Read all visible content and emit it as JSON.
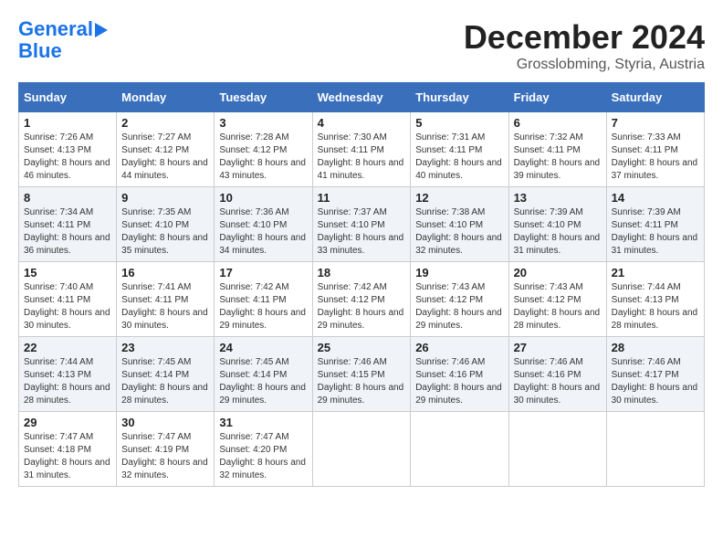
{
  "logo": {
    "line1": "General",
    "line2": "Blue",
    "arrow": true
  },
  "title": {
    "month": "December 2024",
    "location": "Grosslobming, Styria, Austria"
  },
  "weekdays": [
    "Sunday",
    "Monday",
    "Tuesday",
    "Wednesday",
    "Thursday",
    "Friday",
    "Saturday"
  ],
  "weeks": [
    [
      {
        "day": "1",
        "sunrise": "7:26 AM",
        "sunset": "4:13 PM",
        "daylight": "8 hours and 46 minutes."
      },
      {
        "day": "2",
        "sunrise": "7:27 AM",
        "sunset": "4:12 PM",
        "daylight": "8 hours and 44 minutes."
      },
      {
        "day": "3",
        "sunrise": "7:28 AM",
        "sunset": "4:12 PM",
        "daylight": "8 hours and 43 minutes."
      },
      {
        "day": "4",
        "sunrise": "7:30 AM",
        "sunset": "4:11 PM",
        "daylight": "8 hours and 41 minutes."
      },
      {
        "day": "5",
        "sunrise": "7:31 AM",
        "sunset": "4:11 PM",
        "daylight": "8 hours and 40 minutes."
      },
      {
        "day": "6",
        "sunrise": "7:32 AM",
        "sunset": "4:11 PM",
        "daylight": "8 hours and 39 minutes."
      },
      {
        "day": "7",
        "sunrise": "7:33 AM",
        "sunset": "4:11 PM",
        "daylight": "8 hours and 37 minutes."
      }
    ],
    [
      {
        "day": "8",
        "sunrise": "7:34 AM",
        "sunset": "4:11 PM",
        "daylight": "8 hours and 36 minutes."
      },
      {
        "day": "9",
        "sunrise": "7:35 AM",
        "sunset": "4:10 PM",
        "daylight": "8 hours and 35 minutes."
      },
      {
        "day": "10",
        "sunrise": "7:36 AM",
        "sunset": "4:10 PM",
        "daylight": "8 hours and 34 minutes."
      },
      {
        "day": "11",
        "sunrise": "7:37 AM",
        "sunset": "4:10 PM",
        "daylight": "8 hours and 33 minutes."
      },
      {
        "day": "12",
        "sunrise": "7:38 AM",
        "sunset": "4:10 PM",
        "daylight": "8 hours and 32 minutes."
      },
      {
        "day": "13",
        "sunrise": "7:39 AM",
        "sunset": "4:10 PM",
        "daylight": "8 hours and 31 minutes."
      },
      {
        "day": "14",
        "sunrise": "7:39 AM",
        "sunset": "4:11 PM",
        "daylight": "8 hours and 31 minutes."
      }
    ],
    [
      {
        "day": "15",
        "sunrise": "7:40 AM",
        "sunset": "4:11 PM",
        "daylight": "8 hours and 30 minutes."
      },
      {
        "day": "16",
        "sunrise": "7:41 AM",
        "sunset": "4:11 PM",
        "daylight": "8 hours and 30 minutes."
      },
      {
        "day": "17",
        "sunrise": "7:42 AM",
        "sunset": "4:11 PM",
        "daylight": "8 hours and 29 minutes."
      },
      {
        "day": "18",
        "sunrise": "7:42 AM",
        "sunset": "4:12 PM",
        "daylight": "8 hours and 29 minutes."
      },
      {
        "day": "19",
        "sunrise": "7:43 AM",
        "sunset": "4:12 PM",
        "daylight": "8 hours and 29 minutes."
      },
      {
        "day": "20",
        "sunrise": "7:43 AM",
        "sunset": "4:12 PM",
        "daylight": "8 hours and 28 minutes."
      },
      {
        "day": "21",
        "sunrise": "7:44 AM",
        "sunset": "4:13 PM",
        "daylight": "8 hours and 28 minutes."
      }
    ],
    [
      {
        "day": "22",
        "sunrise": "7:44 AM",
        "sunset": "4:13 PM",
        "daylight": "8 hours and 28 minutes."
      },
      {
        "day": "23",
        "sunrise": "7:45 AM",
        "sunset": "4:14 PM",
        "daylight": "8 hours and 28 minutes."
      },
      {
        "day": "24",
        "sunrise": "7:45 AM",
        "sunset": "4:14 PM",
        "daylight": "8 hours and 29 minutes."
      },
      {
        "day": "25",
        "sunrise": "7:46 AM",
        "sunset": "4:15 PM",
        "daylight": "8 hours and 29 minutes."
      },
      {
        "day": "26",
        "sunrise": "7:46 AM",
        "sunset": "4:16 PM",
        "daylight": "8 hours and 29 minutes."
      },
      {
        "day": "27",
        "sunrise": "7:46 AM",
        "sunset": "4:16 PM",
        "daylight": "8 hours and 30 minutes."
      },
      {
        "day": "28",
        "sunrise": "7:46 AM",
        "sunset": "4:17 PM",
        "daylight": "8 hours and 30 minutes."
      }
    ],
    [
      {
        "day": "29",
        "sunrise": "7:47 AM",
        "sunset": "4:18 PM",
        "daylight": "8 hours and 31 minutes."
      },
      {
        "day": "30",
        "sunrise": "7:47 AM",
        "sunset": "4:19 PM",
        "daylight": "8 hours and 32 minutes."
      },
      {
        "day": "31",
        "sunrise": "7:47 AM",
        "sunset": "4:20 PM",
        "daylight": "8 hours and 32 minutes."
      },
      null,
      null,
      null,
      null
    ]
  ],
  "labels": {
    "sunrise": "Sunrise:",
    "sunset": "Sunset:",
    "daylight": "Daylight:"
  }
}
